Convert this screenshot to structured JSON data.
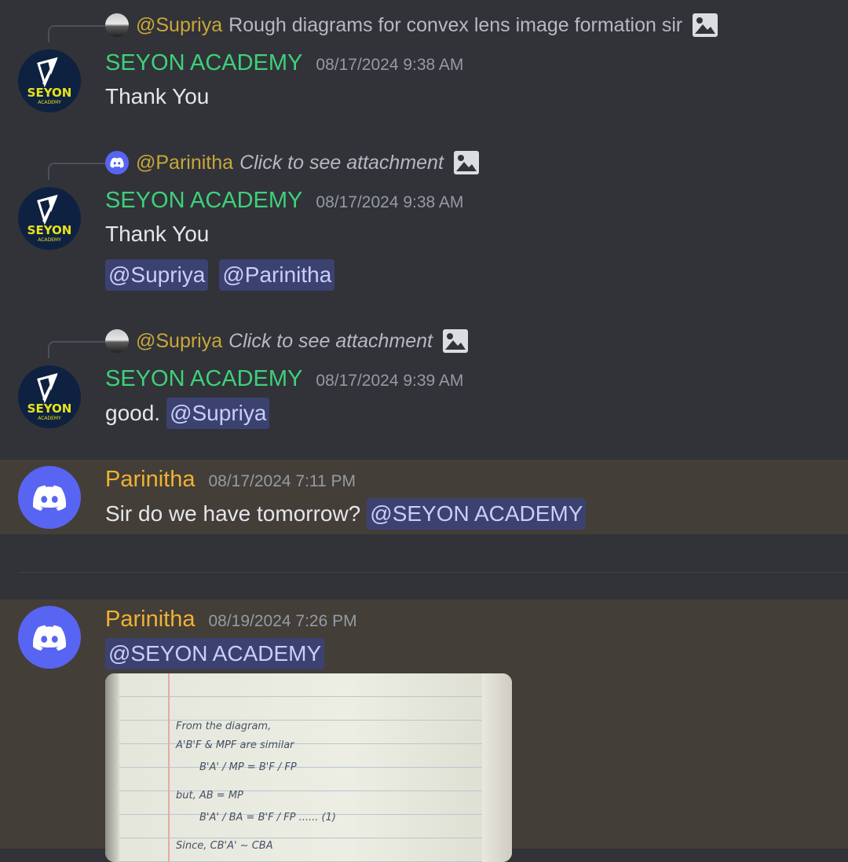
{
  "messages": [
    {
      "reply": {
        "author": "@Supriya",
        "text": "Rough diagrams for convex lens image formation sir",
        "italic": false
      },
      "author": "SEYON ACADEMY",
      "timestamp": "08/17/2024 9:38 AM",
      "text": "Thank You"
    },
    {
      "reply": {
        "author": "@Parinitha",
        "text": "Click to see attachment",
        "italic": true
      },
      "author": "SEYON ACADEMY",
      "timestamp": "08/17/2024 9:38 AM",
      "text": "Thank You",
      "mentions": [
        "@Supriya",
        "@Parinitha"
      ]
    },
    {
      "reply": {
        "author": "@Supriya",
        "text": "Click to see attachment",
        "italic": true
      },
      "author": "SEYON ACADEMY",
      "timestamp": "08/17/2024 9:39 AM",
      "text": "good.",
      "mention": "@Supriya"
    },
    {
      "author": "Parinitha",
      "timestamp": "08/17/2024 7:11 PM",
      "text": "Sir do we have tomorrow?",
      "mention": "@SEYON ACADEMY"
    },
    {
      "author": "Parinitha",
      "timestamp": "08/19/2024 7:26 PM",
      "mention": "@SEYON ACADEMY",
      "attachment": {
        "type": "image",
        "description_lines": [
          "From the diagram,",
          "A'B'F & MPF are similar",
          "B'A' / MP = B'F / FP",
          "but, AB = MP",
          "B'A' / BA = B'F / FP ...... (1)",
          "Since, CB'A' ~ CBA"
        ]
      }
    }
  ],
  "colors": {
    "background": "#313338",
    "highlight": "#433e38",
    "author_academy": "#3fd07a",
    "author_parinitha": "#f0b232",
    "mention_bg": "#3c4270",
    "mention_fg": "#c9cdfb"
  },
  "icons": {
    "seyon_logo": "seyon-academy-logo",
    "discord_avatar": "discord-logo-icon",
    "image_attachment": "image-icon"
  }
}
